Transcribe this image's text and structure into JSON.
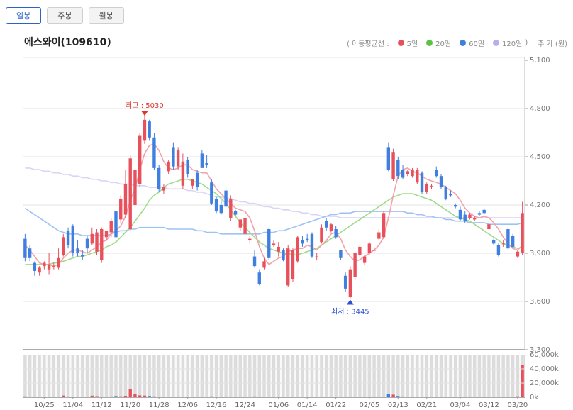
{
  "tabs": [
    {
      "label": "일봉",
      "active": true
    },
    {
      "label": "주봉",
      "active": false
    },
    {
      "label": "월봉",
      "active": false
    }
  ],
  "stock_title": "에스와이(109610)",
  "legend": {
    "prefix": "( 이동평균선 :",
    "items": [
      {
        "label": "5일",
        "color": "#e8505b"
      },
      {
        "label": "20일",
        "color": "#5ac43e"
      },
      {
        "label": "60일",
        "color": "#3f7fe0"
      },
      {
        "label": "120일",
        "color": "#b3aff0"
      }
    ],
    "suffix": ")",
    "unit": "주 가 (원)"
  },
  "colors": {
    "up": "#e8505b",
    "down": "#3f7fe0",
    "ma5": "#f2a3a8",
    "ma20": "#9fdc8a",
    "ma60": "#9ec2f2",
    "ma120": "#d8d4f6",
    "volume_bar": "#dcdcdc"
  },
  "annotations": {
    "high": "최고 : 5030",
    "low": "최저 : 3445"
  },
  "chart_data": {
    "type": "candlestick",
    "ylim": [
      3300,
      5100
    ],
    "y_ticks": [
      "3,300",
      "3,600",
      "3,900",
      "4,200",
      "4,500",
      "4,800",
      "5,100"
    ],
    "volume_ylim": [
      0,
      60000
    ],
    "volume_ticks": [
      "0k",
      "20,000k",
      "40,000k",
      "60,000k"
    ],
    "x_ticks": [
      "10/25",
      "11/04",
      "11/12",
      "11/20",
      "11/28",
      "12/06",
      "12/16",
      "12/24",
      "01/06",
      "01/14",
      "01/22",
      "02/05",
      "02/13",
      "02/21",
      "03/04",
      "03/12",
      "03/20"
    ],
    "x_tick_index": [
      4,
      10,
      16,
      22,
      28,
      34,
      40,
      46,
      53,
      59,
      65,
      72,
      78,
      84,
      91,
      97,
      103
    ],
    "open": [
      3990,
      3930,
      3840,
      3780,
      3820,
      3800,
      3820,
      3810,
      3890,
      4040,
      4070,
      3930,
      3890,
      3990,
      3960,
      3910,
      3860,
      4000,
      4030,
      4160,
      4110,
      4140,
      4050,
      4200,
      4330,
      4600,
      4720,
      4620,
      4430,
      4290,
      4410,
      4560,
      4440,
      4320,
      4480,
      4320,
      4400,
      4520,
      4460,
      4340,
      4240,
      4200,
      4290,
      4120,
      4160,
      4060,
      4020,
      3980,
      3880,
      3780,
      3810,
      4050,
      3950,
      3910,
      3920,
      3700,
      3740,
      3850,
      3980,
      3990,
      4020,
      3880,
      3970,
      4100,
      4040,
      4050,
      3920,
      3760,
      3630,
      3750,
      3890,
      3840,
      3900,
      3920,
      3990,
      4000,
      4560,
      4360,
      4480,
      4420,
      4390,
      4380,
      4340,
      4400,
      4280,
      4320,
      4420,
      4380,
      4310,
      4270,
      4200,
      4170,
      4140,
      4120,
      4110,
      4150,
      4170,
      4050,
      3980,
      3950,
      3960,
      4050,
      4010,
      3880,
      3900
    ],
    "close": [
      3870,
      3870,
      3790,
      3810,
      3840,
      3830,
      3820,
      3870,
      4000,
      3950,
      3900,
      3900,
      3880,
      3930,
      4020,
      4030,
      4050,
      4040,
      4100,
      4000,
      4240,
      4330,
      4490,
      4420,
      4630,
      4730,
      4620,
      4430,
      4300,
      4310,
      4470,
      4440,
      4540,
      4470,
      4390,
      4360,
      4310,
      4430,
      4450,
      4210,
      4160,
      4150,
      4190,
      4240,
      4140,
      4110,
      4120,
      3990,
      3820,
      3710,
      3850,
      3870,
      3960,
      3940,
      3860,
      3930,
      3920,
      4000,
      3960,
      3980,
      3880,
      3880,
      4060,
      4060,
      4080,
      4000,
      3870,
      3680,
      3800,
      3900,
      3940,
      3880,
      3960,
      3920,
      4030,
      4150,
      4420,
      4530,
      4380,
      4370,
      4410,
      4420,
      4420,
      4280,
      4330,
      4320,
      4380,
      4310,
      4240,
      4260,
      4190,
      4110,
      4100,
      4140,
      4120,
      4140,
      4150,
      4080,
      3960,
      3890,
      3960,
      3930,
      3940,
      3910,
      4150
    ],
    "high": [
      4020,
      3950,
      3850,
      3820,
      3850,
      3900,
      3840,
      3930,
      4020,
      4060,
      4080,
      3980,
      3920,
      4010,
      4060,
      4050,
      4060,
      4040,
      4120,
      4180,
      4260,
      4420,
      4510,
      4440,
      4650,
      4760,
      4730,
      4650,
      4450,
      4330,
      4480,
      4590,
      4560,
      4520,
      4500,
      4360,
      4420,
      4540,
      4510,
      4360,
      4250,
      4230,
      4310,
      4260,
      4170,
      4080,
      4130,
      4010,
      3920,
      3800,
      3870,
      4060,
      3980,
      3970,
      3930,
      3950,
      3930,
      4010,
      4010,
      4020,
      4030,
      3900,
      4080,
      4120,
      4090,
      4070,
      3920,
      3780,
      3820,
      3910,
      3950,
      3890,
      3970,
      3940,
      4050,
      4160,
      4590,
      4550,
      4500,
      4450,
      4420,
      4430,
      4430,
      4410,
      4340,
      4330,
      4440,
      4390,
      4320,
      4290,
      4210,
      4190,
      4160,
      4150,
      4130,
      4160,
      4180,
      4100,
      3990,
      3960,
      3980,
      4060,
      4020,
      3920,
      4220
    ],
    "low": [
      3850,
      3850,
      3760,
      3760,
      3800,
      3770,
      3800,
      3800,
      3880,
      3930,
      3880,
      3880,
      3860,
      3900,
      3950,
      3890,
      3840,
      3980,
      4000,
      3980,
      4090,
      4120,
      4040,
      4180,
      4310,
      4580,
      4600,
      4420,
      4280,
      4270,
      4390,
      4420,
      4420,
      4300,
      4370,
      4300,
      4290,
      4500,
      4430,
      4200,
      4150,
      4140,
      4180,
      4100,
      4130,
      4040,
      4010,
      3960,
      3810,
      3700,
      3800,
      3860,
      3940,
      3880,
      3850,
      3690,
      3720,
      3840,
      3940,
      3970,
      3870,
      3860,
      3960,
      4040,
      4030,
      3990,
      3860,
      3660,
      3620,
      3730,
      3870,
      3830,
      3890,
      3900,
      3980,
      3990,
      4410,
      4350,
      4360,
      4360,
      4380,
      4370,
      4330,
      4270,
      4270,
      4300,
      4370,
      4300,
      4230,
      4250,
      4180,
      4100,
      4090,
      4110,
      4100,
      4130,
      4140,
      4040,
      3950,
      3880,
      3940,
      3920,
      3930,
      3870,
      3890
    ],
    "volume": [
      1200,
      900,
      700,
      800,
      600,
      500,
      700,
      900,
      2400,
      1100,
      800,
      700,
      600,
      900,
      2200,
      1500,
      900,
      700,
      1100,
      1700,
      1300,
      2000,
      11000,
      4000,
      2600,
      2300,
      1800,
      1200,
      900,
      800,
      700,
      900,
      800,
      700,
      800,
      600,
      700,
      900,
      800,
      1200,
      900,
      700,
      600,
      700,
      800,
      600,
      600,
      900,
      1100,
      1000,
      800,
      700,
      800,
      700,
      900,
      800,
      700,
      800,
      900,
      800,
      700,
      600,
      800,
      900,
      800,
      700,
      600,
      700,
      800,
      700,
      600,
      500,
      600,
      700,
      800,
      900,
      4200,
      3600,
      1800,
      1100,
      900,
      800,
      700,
      600,
      800,
      700,
      900,
      800,
      700,
      600,
      800,
      700,
      600,
      500,
      700,
      600,
      500,
      600,
      700,
      800,
      900,
      1000,
      800,
      1300,
      46000
    ],
    "ma5": [
      3950,
      3920,
      3880,
      3840,
      3830,
      3830,
      3820,
      3830,
      3870,
      3900,
      3920,
      3920,
      3910,
      3900,
      3920,
      3940,
      3970,
      3980,
      4020,
      4040,
      4070,
      4130,
      4230,
      4300,
      4420,
      4520,
      4570,
      4580,
      4540,
      4470,
      4430,
      4420,
      4430,
      4450,
      4450,
      4420,
      4410,
      4400,
      4400,
      4350,
      4300,
      4270,
      4240,
      4210,
      4180,
      4170,
      4160,
      4120,
      4040,
      3940,
      3870,
      3830,
      3850,
      3870,
      3880,
      3910,
      3920,
      3930,
      3930,
      3950,
      3940,
      3920,
      3950,
      3980,
      4020,
      4030,
      3990,
      3920,
      3880,
      3850,
      3860,
      3880,
      3900,
      3920,
      3950,
      4000,
      4120,
      4260,
      4380,
      4420,
      4430,
      4410,
      4400,
      4380,
      4360,
      4350,
      4340,
      4330,
      4310,
      4290,
      4270,
      4230,
      4180,
      4150,
      4130,
      4120,
      4130,
      4120,
      4090,
      4050,
      4000,
      3960,
      3930,
      3920,
      3950
    ],
    "ma20": [
      3830,
      3830,
      3830,
      3830,
      3830,
      3830,
      3840,
      3840,
      3850,
      3860,
      3870,
      3880,
      3880,
      3890,
      3900,
      3910,
      3920,
      3940,
      3950,
      3970,
      4000,
      4030,
      4060,
      4100,
      4140,
      4180,
      4230,
      4260,
      4280,
      4310,
      4330,
      4340,
      4350,
      4360,
      4360,
      4350,
      4340,
      4330,
      4310,
      4290,
      4270,
      4240,
      4210,
      4170,
      4130,
      4090,
      4060,
      4030,
      4000,
      3970,
      3950,
      3930,
      3920,
      3910,
      3900,
      3900,
      3890,
      3890,
      3900,
      3910,
      3920,
      3930,
      3950,
      3970,
      3990,
      4010,
      4030,
      4050,
      4070,
      4090,
      4110,
      4130,
      4150,
      4170,
      4190,
      4210,
      4230,
      4250,
      4260,
      4270,
      4270,
      4270,
      4260,
      4250,
      4240,
      4230,
      4210,
      4190,
      4170,
      4150,
      4130,
      4120,
      4110,
      4100,
      4080,
      4060,
      4040,
      4020,
      4000,
      3980,
      3960,
      3950,
      3940,
      3930,
      3940
    ],
    "ma60": [
      4180,
      4160,
      4140,
      4120,
      4100,
      4080,
      4060,
      4040,
      4030,
      4020,
      4020,
      4020,
      4010,
      4010,
      4010,
      4010,
      4010,
      4010,
      4020,
      4030,
      4040,
      4040,
      4050,
      4050,
      4060,
      4060,
      4060,
      4060,
      4060,
      4060,
      4050,
      4050,
      4050,
      4050,
      4050,
      4050,
      4040,
      4040,
      4030,
      4030,
      4030,
      4020,
      4020,
      4020,
      4020,
      4020,
      4020,
      4020,
      4020,
      4020,
      4030,
      4030,
      4030,
      4040,
      4040,
      4050,
      4060,
      4070,
      4080,
      4090,
      4100,
      4110,
      4120,
      4130,
      4140,
      4140,
      4150,
      4150,
      4150,
      4160,
      4160,
      4160,
      4160,
      4160,
      4160,
      4160,
      4160,
      4160,
      4160,
      4160,
      4150,
      4150,
      4140,
      4140,
      4130,
      4130,
      4120,
      4120,
      4110,
      4110,
      4100,
      4100,
      4100,
      4090,
      4090,
      4090,
      4090,
      4080,
      4080,
      4080,
      4080,
      4080,
      4080,
      4080,
      4090
    ],
    "ma120": [
      4430,
      4430,
      4420,
      4420,
      4410,
      4410,
      4400,
      4400,
      4390,
      4390,
      4380,
      4380,
      4370,
      4370,
      4360,
      4360,
      4350,
      4350,
      4340,
      4340,
      4330,
      4330,
      4330,
      4320,
      4320,
      4320,
      4310,
      4310,
      4310,
      4310,
      4300,
      4300,
      4300,
      4300,
      4290,
      4290,
      4280,
      4280,
      4270,
      4260,
      4250,
      4250,
      4240,
      4240,
      4230,
      4220,
      4220,
      4210,
      4210,
      4200,
      4190,
      4190,
      4180,
      4180,
      4170,
      4170,
      4160,
      4160,
      4150,
      4150,
      4140,
      4140,
      4130,
      4130,
      4130,
      4130,
      4120,
      4120,
      4120,
      4120,
      4120,
      4120,
      4120,
      4120,
      4120,
      4120,
      4120,
      4120,
      4120,
      4120,
      4120,
      4120,
      4120,
      4120,
      4120,
      4120,
      4120,
      4120,
      4120,
      4120,
      4120,
      4120,
      4120,
      4120,
      4120,
      4120,
      4120,
      4120,
      4120,
      4120,
      4120,
      4120,
      4120,
      4120,
      4120
    ]
  }
}
